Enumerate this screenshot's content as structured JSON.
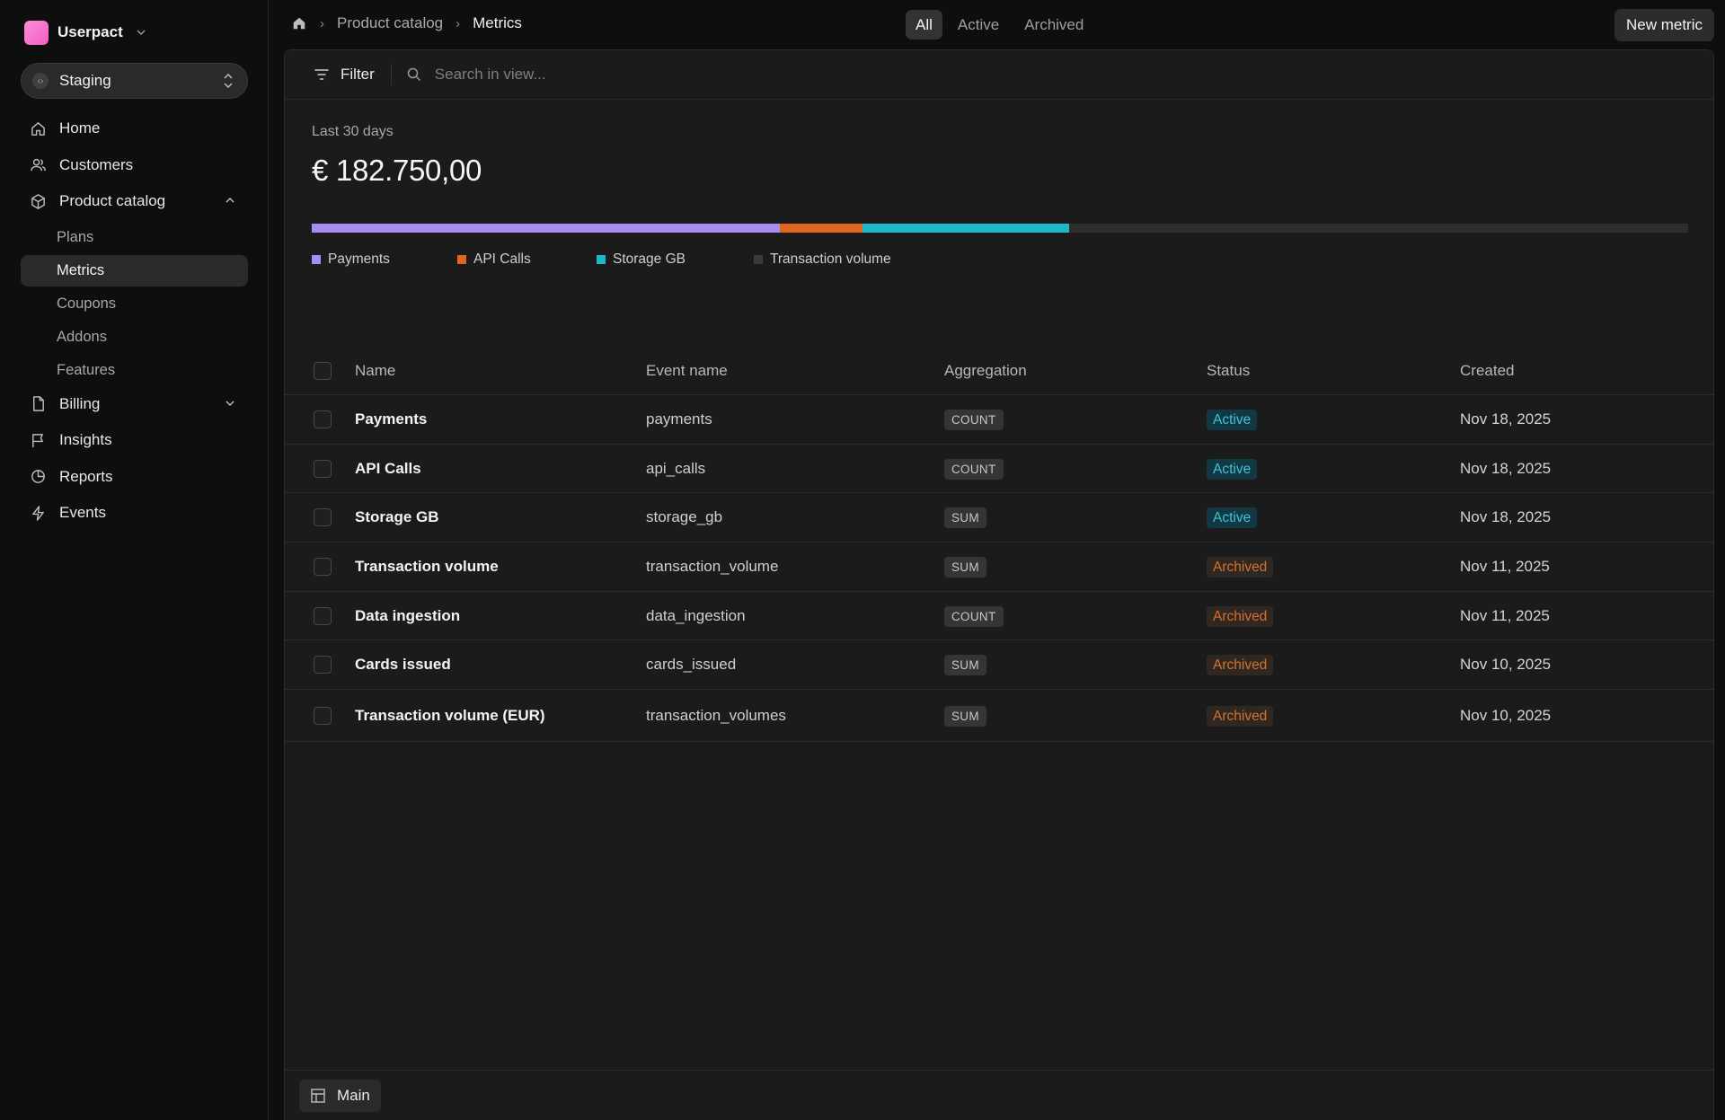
{
  "workspace": {
    "name": "Userpact",
    "accent": "#f25cc8"
  },
  "environment": {
    "label": "Staging"
  },
  "nav": {
    "home": "Home",
    "customers": "Customers",
    "product_catalog": "Product catalog",
    "sub": [
      "Plans",
      "Metrics",
      "Coupons",
      "Addons",
      "Features"
    ],
    "active_sub": "Metrics",
    "billing": "Billing",
    "insights": "Insights",
    "reports": "Reports",
    "events": "Events"
  },
  "breadcrumb": {
    "parent": "Product catalog",
    "current": "Metrics"
  },
  "tabs": [
    "All",
    "Active",
    "Archived"
  ],
  "active_tab": "All",
  "new_button": "New metric",
  "toolbar": {
    "filter": "Filter",
    "search_placeholder": "Search in view..."
  },
  "summary": {
    "period": "Last 30 days",
    "total": "€ 182.750,00"
  },
  "chart_data": {
    "type": "bar",
    "categories": [
      "Payments",
      "API Calls",
      "Storage GB",
      "Transaction volume"
    ],
    "values": [
      34,
      6,
      15,
      45
    ],
    "unit": "percent",
    "colors": [
      "#a98bf2",
      "#e0661d",
      "#1cb8c8",
      "#2e2e2e"
    ]
  },
  "table": {
    "headers": {
      "name": "Name",
      "event": "Event name",
      "aggregation": "Aggregation",
      "status": "Status",
      "created": "Created"
    },
    "rows": [
      {
        "name": "Payments",
        "event": "payments",
        "aggregation": "COUNT",
        "status": "Active",
        "created": "Nov 18, 2025"
      },
      {
        "name": "API Calls",
        "event": "api_calls",
        "aggregation": "COUNT",
        "status": "Active",
        "created": "Nov 18, 2025"
      },
      {
        "name": "Storage GB",
        "event": "storage_gb",
        "aggregation": "SUM",
        "status": "Active",
        "created": "Nov 18, 2025"
      },
      {
        "name": "Transaction volume",
        "event": "transaction_volume",
        "aggregation": "SUM",
        "status": "Archived",
        "created": "Nov 11, 2025"
      },
      {
        "name": "Data ingestion",
        "event": "data_ingestion",
        "aggregation": "COUNT",
        "status": "Archived",
        "created": "Nov 11, 2025"
      },
      {
        "name": "Cards issued",
        "event": "cards_issued",
        "aggregation": "SUM",
        "status": "Archived",
        "created": "Nov 10, 2025"
      },
      {
        "name": "Transaction volume (EUR)",
        "event": "transaction_volumes",
        "aggregation": "SUM",
        "status": "Archived",
        "created": "Nov 10, 2025"
      }
    ]
  },
  "footer": {
    "view_tab": "Main"
  }
}
